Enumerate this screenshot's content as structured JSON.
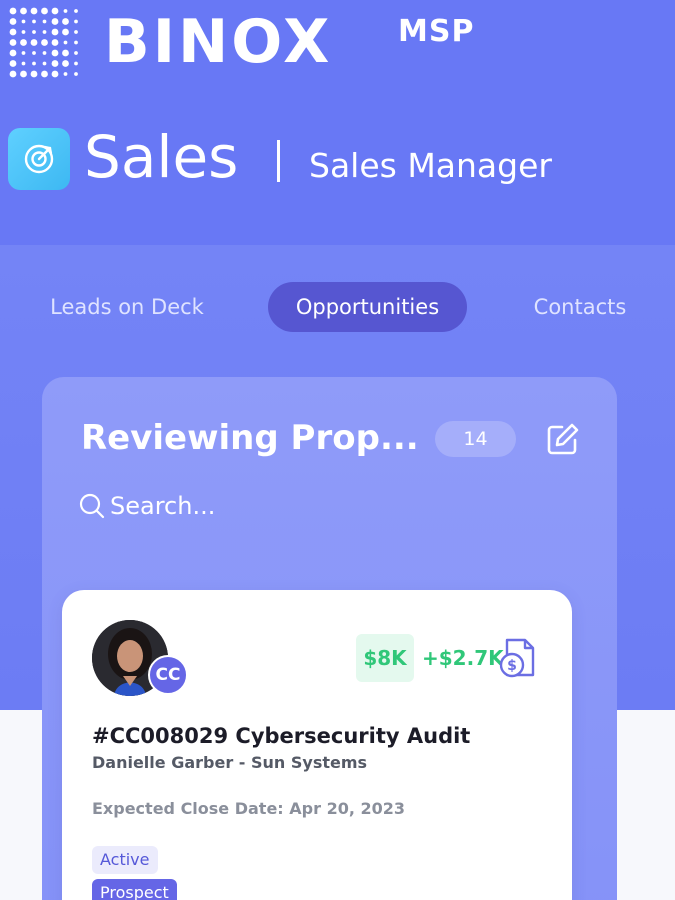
{
  "brand": {
    "name": "BINOX",
    "suffix": "MSP"
  },
  "header": {
    "title": "Sales",
    "subtitle": "Sales Manager"
  },
  "tabs": [
    {
      "label": "Leads on Deck",
      "active": false
    },
    {
      "label": "Opportunities",
      "active": true
    },
    {
      "label": "Contacts",
      "active": false
    }
  ],
  "column": {
    "title": "Reviewing Prop...",
    "count": "14",
    "search_placeholder": "Search..."
  },
  "card": {
    "avatar_initials": "CC",
    "amount": "$8K",
    "amount_delta": "+$2.7K",
    "title": "#CC008029 Cybersecurity Audit",
    "contact": "Danielle Garber - Sun Systems",
    "close_date": "Expected Close Date: Apr 20, 2023",
    "tags": [
      "Active",
      "Prospect"
    ]
  },
  "icons": {
    "logo": "binox-dot-grid-logo",
    "app": "target-icon",
    "edit": "edit-icon",
    "search": "search-icon",
    "invoice": "invoice-dollar-icon"
  },
  "colors": {
    "header_bg": "#6878f5",
    "active_tab_bg": "#5656d1",
    "column_bg": "#8f9bf9",
    "money_green": "#30c779",
    "badge_purple": "#6566e6",
    "app_icon": "#4cc4f9"
  }
}
